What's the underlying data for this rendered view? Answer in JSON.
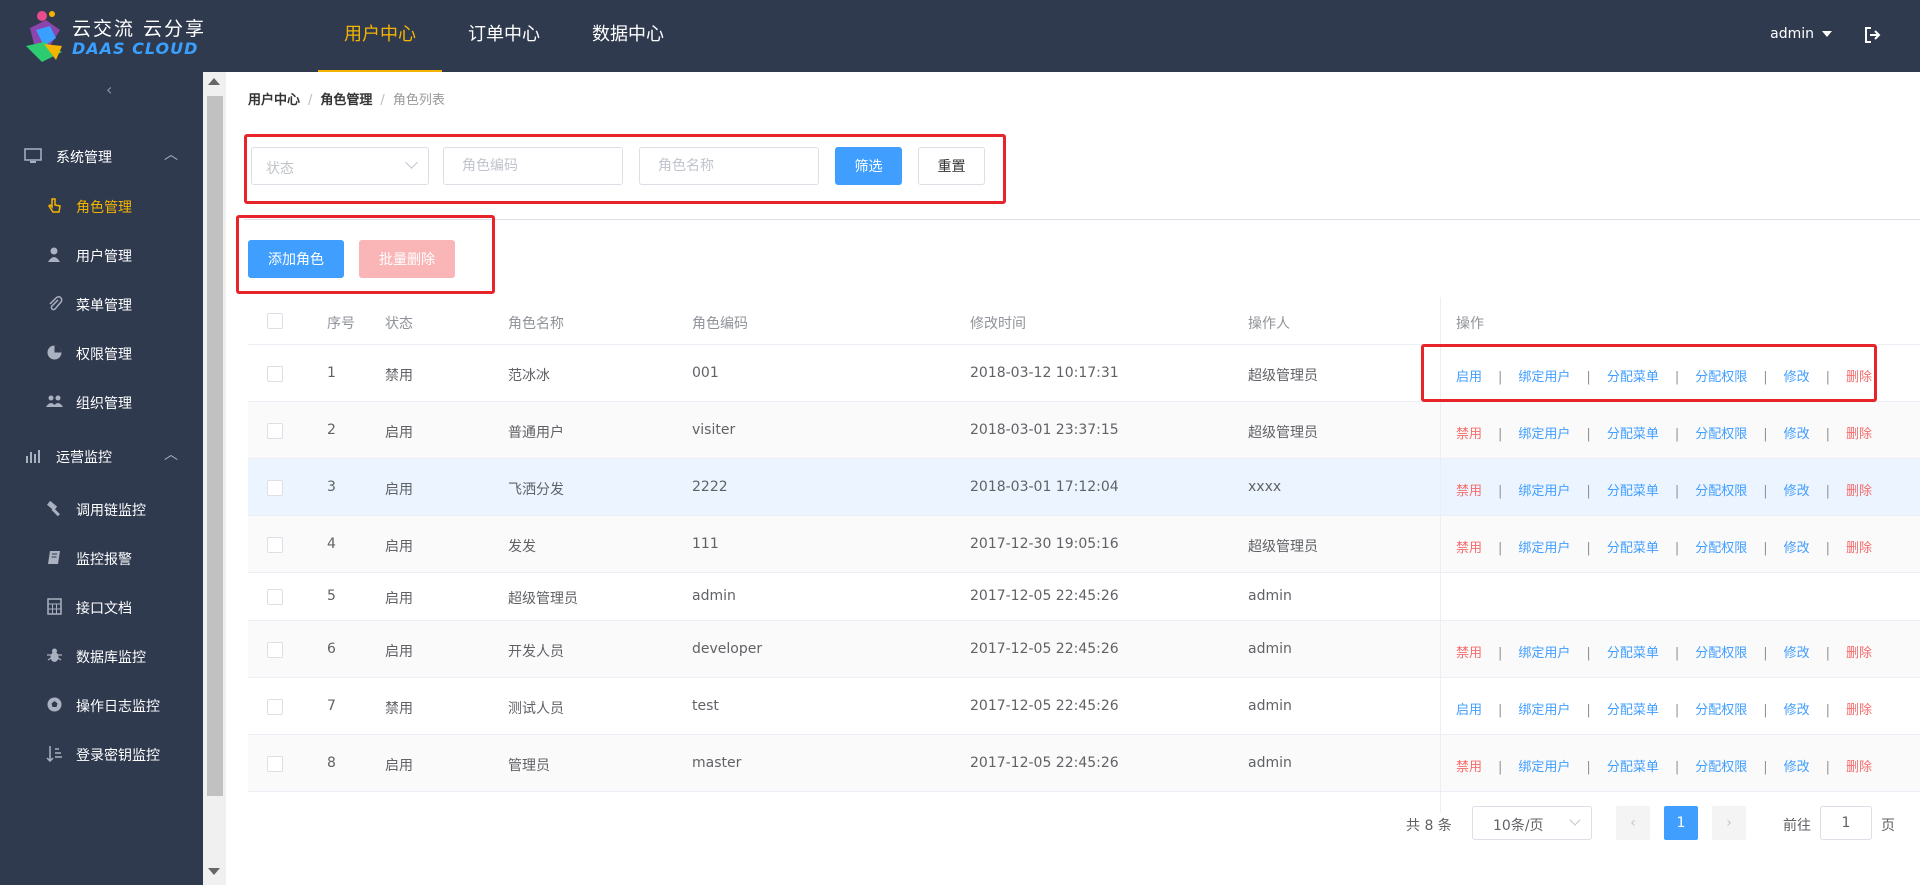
{
  "brand": {
    "line1": "云交流 云分享",
    "line2": "DAAS CLOUD"
  },
  "topnav": [
    {
      "label": "用户中心",
      "active": true
    },
    {
      "label": "订单中心",
      "active": false
    },
    {
      "label": "数据中心",
      "active": false
    }
  ],
  "user": {
    "name": "admin"
  },
  "sidebar": {
    "groups": [
      {
        "label": "系统管理",
        "icon": "monitor-icon"
      },
      {
        "label": "运营监控",
        "icon": "bar-chart-icon"
      }
    ],
    "items": [
      {
        "label": "角色管理",
        "icon": "hand-pointer-icon"
      },
      {
        "label": "用户管理",
        "icon": "user-icon"
      },
      {
        "label": "菜单管理",
        "icon": "paperclip-icon"
      },
      {
        "label": "权限管理",
        "icon": "pie-icon"
      },
      {
        "label": "组织管理",
        "icon": "users-icon"
      },
      {
        "label": "调用链监控",
        "icon": "hammer-icon"
      },
      {
        "label": "监控报警",
        "icon": "book-icon"
      },
      {
        "label": "接口文档",
        "icon": "calculator-icon"
      },
      {
        "label": "数据库监控",
        "icon": "bug-icon"
      },
      {
        "label": "操作日志监控",
        "icon": "football-icon"
      },
      {
        "label": "登录密钥监控",
        "icon": "sort-icon"
      }
    ]
  },
  "breadcrumb": [
    "用户中心",
    "角色管理",
    "角色列表"
  ],
  "filter": {
    "status_placeholder": "状态",
    "code_placeholder": "角色编码",
    "name_placeholder": "角色名称",
    "filter_btn": "筛选",
    "reset_btn": "重置"
  },
  "actions": {
    "add": "添加角色",
    "batch_delete": "批量删除"
  },
  "table": {
    "headers": [
      "序号",
      "状态",
      "角色名称",
      "角色编码",
      "修改时间",
      "操作人",
      "操作"
    ],
    "rows": [
      {
        "no": "1",
        "status": "禁用",
        "name": "范冰冰",
        "code": "001",
        "time": "2018-03-12 10:17:31",
        "operator": "超级管理员",
        "toggle": "启用"
      },
      {
        "no": "2",
        "status": "启用",
        "name": "普通用户",
        "code": "visiter",
        "time": "2018-03-01 23:37:15",
        "operator": "超级管理员",
        "toggle": "禁用"
      },
      {
        "no": "3",
        "status": "启用",
        "name": "飞洒分发",
        "code": "2222",
        "time": "2018-03-01 17:12:04",
        "operator": "xxxx",
        "toggle": "禁用"
      },
      {
        "no": "4",
        "status": "启用",
        "name": "发发",
        "code": "111",
        "time": "2017-12-30 19:05:16",
        "operator": "超级管理员",
        "toggle": "禁用"
      },
      {
        "no": "5",
        "status": "启用",
        "name": "超级管理员",
        "code": "admin",
        "time": "2017-12-05 22:45:26",
        "operator": "admin",
        "toggle": ""
      },
      {
        "no": "6",
        "status": "启用",
        "name": "开发人员",
        "code": "developer",
        "time": "2017-12-05 22:45:26",
        "operator": "admin",
        "toggle": "禁用"
      },
      {
        "no": "7",
        "status": "禁用",
        "name": "测试人员",
        "code": "test",
        "time": "2017-12-05 22:45:26",
        "operator": "admin",
        "toggle": "启用"
      },
      {
        "no": "8",
        "status": "启用",
        "name": "管理员",
        "code": "master",
        "time": "2017-12-05 22:45:26",
        "operator": "admin",
        "toggle": "禁用"
      }
    ],
    "ops": {
      "bind_user": "绑定用户",
      "assign_menu": "分配菜单",
      "assign_perm": "分配权限",
      "edit": "修改",
      "delete": "删除"
    }
  },
  "pager": {
    "total": "共 8 条",
    "page_size": "10条/页",
    "current": "1",
    "goto": "前往",
    "goto_value": "1",
    "page": "页",
    "prev": "‹",
    "next": "›"
  }
}
